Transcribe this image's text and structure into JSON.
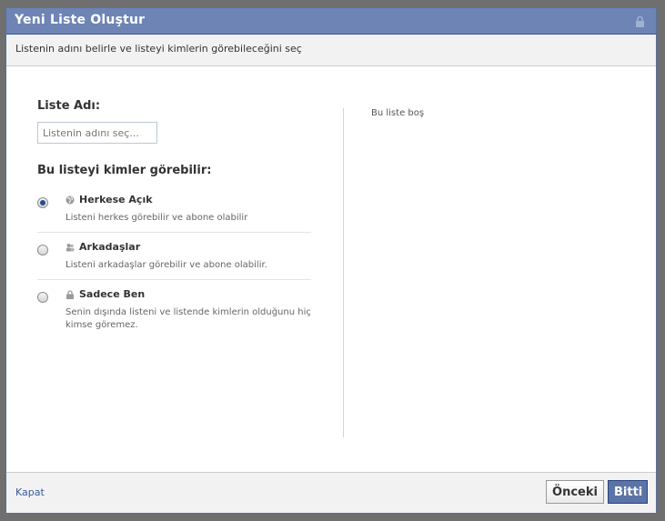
{
  "dialog": {
    "title": "Yeni Liste Oluştur",
    "subtitle": "Listenin adını belirle ve listeyi kimlerin görebileceğini seç"
  },
  "form": {
    "name_label": "Liste Adı:",
    "name_placeholder": "Listenin adını seç...",
    "name_value": "",
    "visibility_label": "Bu listeyi kimler görebilir:",
    "options": [
      {
        "title": "Herkese Açık",
        "description": "Listeni herkes görebilir ve abone olabilir",
        "icon": "globe-icon",
        "selected": true
      },
      {
        "title": "Arkadaşlar",
        "description": "Listeni arkadaşlar görebilir ve abone olabilir.",
        "icon": "friends-icon",
        "selected": false
      },
      {
        "title": "Sadece Ben",
        "description": "Senin dışında listeni ve listende kimlerin olduğunu hiç kimse göremez.",
        "icon": "lock-icon",
        "selected": false
      }
    ]
  },
  "preview": {
    "empty_text": "Bu liste boş"
  },
  "footer": {
    "close_label": "Kapat",
    "prev_label": "Önceki",
    "done_label": "Bitti"
  },
  "colors": {
    "title_bar": "#6d84b4",
    "link": "#3b5998",
    "primary_button": "#5b74a8"
  }
}
